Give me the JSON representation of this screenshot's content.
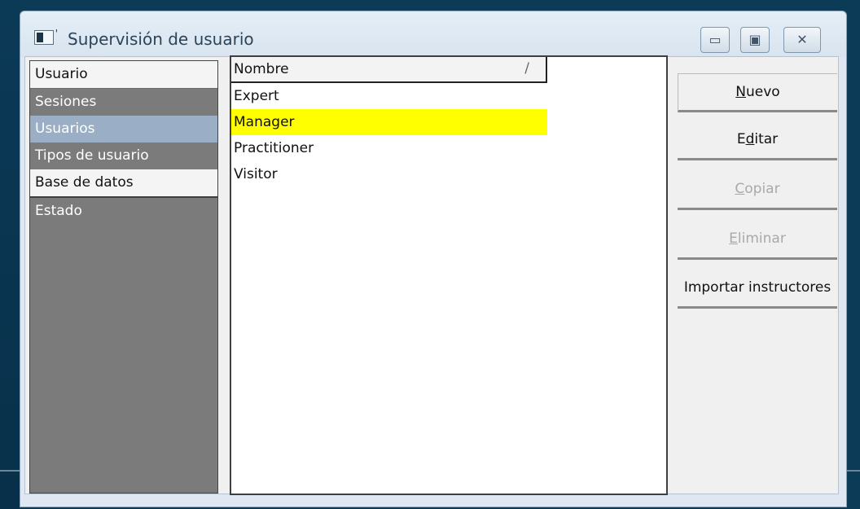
{
  "window": {
    "title": "Supervisión de usuario",
    "controls": [
      "minimize",
      "maximize",
      "close"
    ]
  },
  "nav": {
    "header": "Usuario",
    "items": [
      {
        "label": "Sesiones",
        "state": "normal"
      },
      {
        "label": "Usuarios",
        "state": "selected"
      },
      {
        "label": "Tipos de usuario",
        "state": "normal"
      },
      {
        "label": "Base de datos",
        "state": "section"
      },
      {
        "label": "Estado",
        "state": "normal"
      }
    ]
  },
  "list": {
    "column": "Nombre",
    "sort_indicator": "/",
    "rows": [
      {
        "name": "Expert",
        "highlighted": false
      },
      {
        "name": "Manager",
        "highlighted": true
      },
      {
        "name": "Practitioner",
        "highlighted": false
      },
      {
        "name": "Visitor",
        "highlighted": false
      }
    ]
  },
  "buttons": {
    "new": {
      "prefix": "",
      "mnemonic": "N",
      "suffix": "uevo",
      "enabled": true
    },
    "edit": {
      "prefix": "E",
      "mnemonic": "d",
      "suffix": "itar",
      "enabled": true
    },
    "copy": {
      "prefix": "",
      "mnemonic": "C",
      "suffix": "opiar",
      "enabled": false
    },
    "delete": {
      "prefix": "",
      "mnemonic": "E",
      "suffix": "liminar",
      "enabled": false
    },
    "import": {
      "label": "Importar instructores",
      "enabled": true
    }
  },
  "colors": {
    "highlight": "#ffff00",
    "selected_nav": "#9aaec5",
    "nav_background": "#7b7b7b",
    "desktop": "#0c3b58"
  }
}
